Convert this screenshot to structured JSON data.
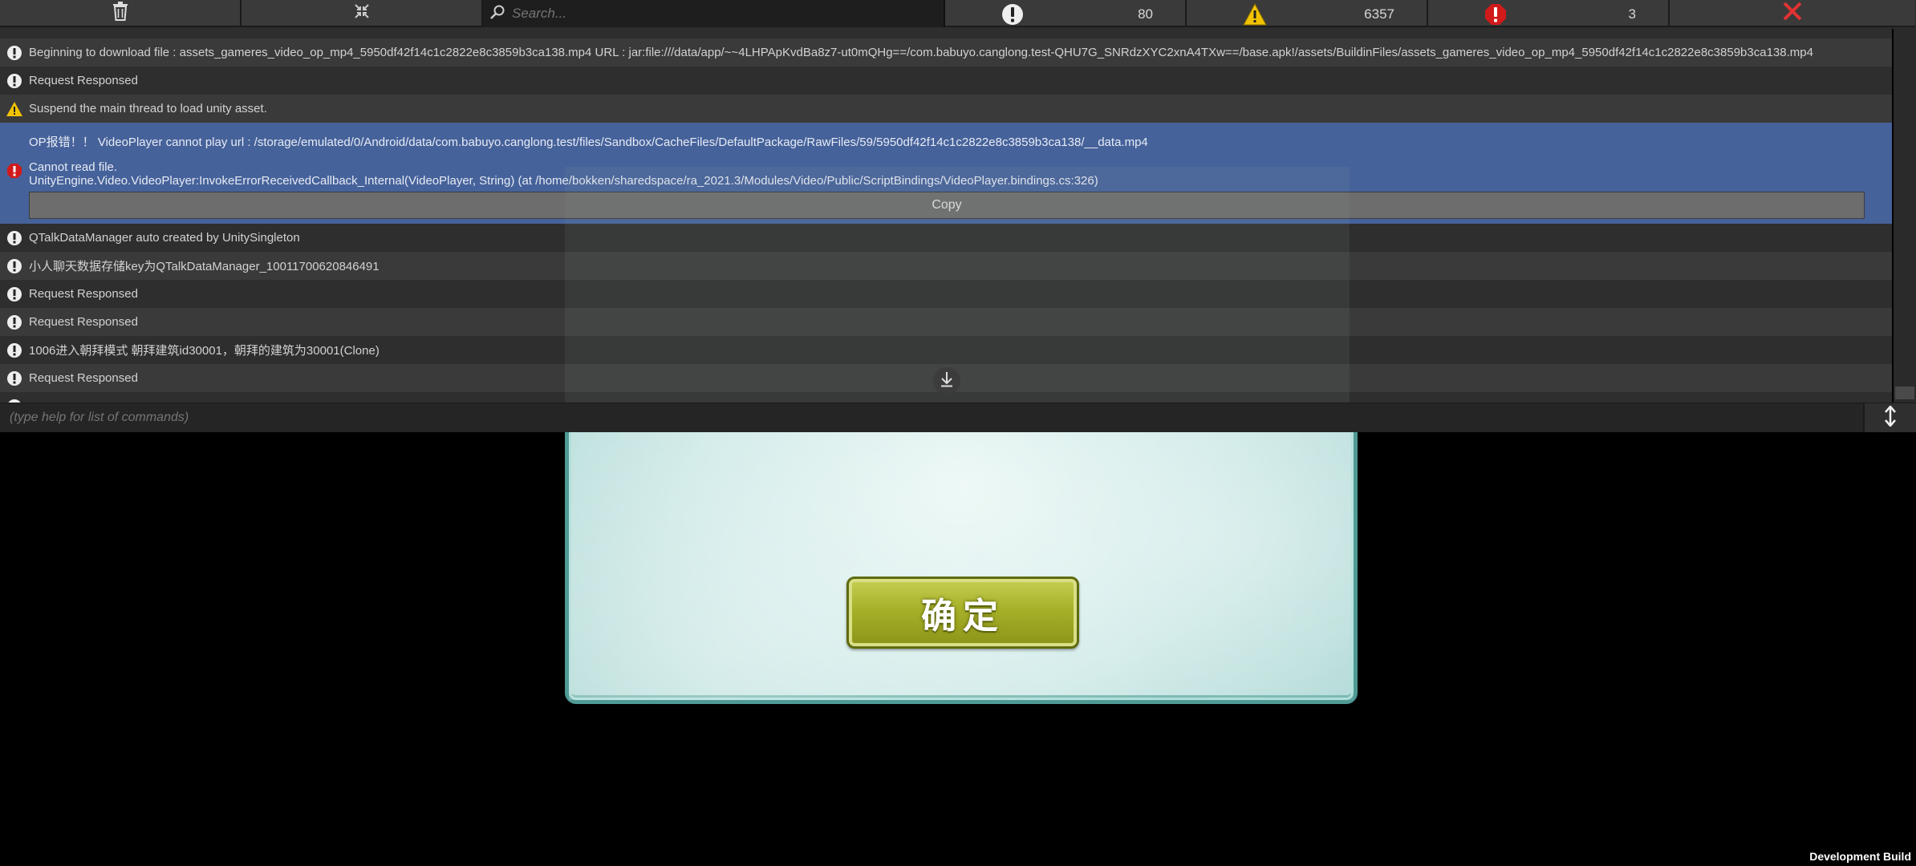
{
  "console": {
    "toolbar": {
      "search_placeholder": "Search...",
      "info_count": "80",
      "warning_count": "6357",
      "error_count": "3"
    },
    "logs": [
      {
        "type": "info",
        "text": "Beginning to download file : assets_gameres_video_op_mp4_5950df42f14c1c2822e8c3859b3ca138.mp4 URL : jar:file:///data/app/~~4LHPApKvdBa8z7-ut0mQHg==/com.babuyo.canglong.test-QHU7G_SNRdzXYC2xnA4TXw==/base.apk!/assets/BuildinFiles/assets_gameres_video_op_mp4_5950df42f14c1c2822e8c3859b3ca138.mp4"
      },
      {
        "type": "info",
        "text": "Request Responsed"
      },
      {
        "type": "warning",
        "text": "Suspend the main thread to load unity asset."
      }
    ],
    "selected_log": {
      "type": "error",
      "line1": "OP报错！！   VideoPlayer cannot play url : /storage/emulated/0/Android/data/com.babuyo.canglong.test/files/Sandbox/CacheFiles/DefaultPackage/RawFiles/59/5950df42f14c1c2822e8c3859b3ca138/__data.mp4",
      "line2": "Cannot read file.",
      "line3": "UnityEngine.Video.VideoPlayer:InvokeErrorReceivedCallback_Internal(VideoPlayer, String) (at /home/bokken/sharedspace/ra_2021.3/Modules/Video/Public/ScriptBindings/VideoPlayer.bindings.cs:326)",
      "copy_label": "Copy"
    },
    "logs_after": [
      {
        "type": "info",
        "text": "QTalkDataManager auto created by UnitySingleton"
      },
      {
        "type": "info",
        "text": "小人聊天数据存储key为QTalkDataManager_10011700620846491"
      },
      {
        "type": "info",
        "text": "Request Responsed"
      },
      {
        "type": "info",
        "text": "Request Responsed"
      },
      {
        "type": "info",
        "text": "1006进入朝拜模式 朝拜建筑id30001，朝拜的建筑为30001(Clone)"
      },
      {
        "type": "info",
        "text": "Request Responsed"
      }
    ],
    "command_placeholder": "(type help for list of commands)"
  },
  "dialog": {
    "confirm_label": "确定"
  },
  "footer": {
    "build_label": "Development Build"
  }
}
